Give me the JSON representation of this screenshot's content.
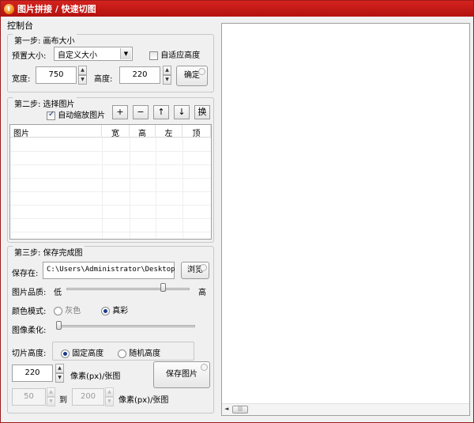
{
  "window": {
    "title": "图片拼接 / 快速切图"
  },
  "control_panel": {
    "label": "控制台"
  },
  "step1": {
    "title": "第一步: 画布大小",
    "preset_label": "预置大小:",
    "preset_value": "自定义大小",
    "auto_height_label": "自适应高度",
    "width_label": "宽度:",
    "width_value": "750",
    "height_label": "高度:",
    "height_value": "220",
    "confirm_label": "确定"
  },
  "step2": {
    "title": "第二步: 选择图片",
    "auto_scale_label": "自动缩放图片",
    "tool_add": "+",
    "tool_remove": "−",
    "tool_up": "↑",
    "tool_down": "↓",
    "tool_swap": "换",
    "columns": [
      "图片",
      "宽",
      "高",
      "左",
      "顶"
    ]
  },
  "step3": {
    "title": "第三步: 保存完成图",
    "save_to_label": "保存在:",
    "save_path": "C:\\Users\\Administrator\\Desktop",
    "browse_label": "浏览",
    "quality_label": "图片品质:",
    "quality_low": "低",
    "quality_high": "高",
    "quality_level": 0.8,
    "color_mode_label": "颜色模式:",
    "color_gray": "灰色",
    "color_true": "真彩",
    "smooth_label": "图像柔化:",
    "smooth_level": 0.0,
    "slice_height_label": "切片高度:",
    "slice_fixed": "固定高度",
    "slice_random": "随机高度",
    "fixed_value": "220",
    "fixed_unit": "像素(px)/张图",
    "save_button": "保存图片",
    "random_from": "50",
    "random_to_label": "到",
    "random_to": "200",
    "random_unit": "像素(px)/张图"
  },
  "preview": {
    "scroll_grip": "|||"
  }
}
